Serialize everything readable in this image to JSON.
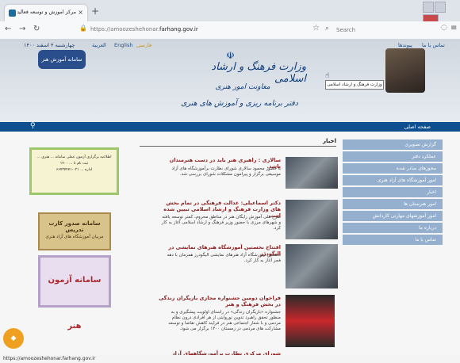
{
  "browser": {
    "tab_title": "مرکز آموزش و توسعه فعالیتهای قرآ",
    "new_tab": "+",
    "url_prefix": "https://amoozeshehonar.",
    "url_domain": "farhang.gov.ir",
    "search_placeholder": "Search",
    "status_url": "https://amoozeshehonar.farhang.gov.ir"
  },
  "header": {
    "date": "چهارشنبه ۴ اسفند ۱۴۰۰",
    "langs": [
      "العربية",
      "English",
      "فارسی"
    ],
    "contact": "تماس با ما",
    "links": "پیوندها",
    "ministry": "وزارت فرهنگ و ارشاد اسلامی",
    "deputy": "معاونت امور هنری",
    "office": "دفتر برنامه ریزی و آموزش های هنری",
    "logo_text": "سامانه آموزش هنر",
    "tooltip": "وزارت فرهنگ و ارشاد اسلامی"
  },
  "nav": {
    "home": "صفحه اصلی",
    "search_icon": "search-icon"
  },
  "menu": [
    "گزارش تصویری",
    "عملکرد دفتر",
    "مجوزهای صادر شده",
    "امور آموزشگاه های آزاد هنری",
    "اخبار",
    "امور هنرستان ها",
    "امور آموزشهای مهارتی کاردانش",
    "درباره ما",
    "تماس با ما"
  ],
  "ads": {
    "ad1_lines": [
      "اطلاعیه برگزاری آزمون عملی سامانه ... هنری ...",
      "ثبت نام تا ... ۱۴۰۰",
      "اداره ... ۰۲۱-۶۶۷۳۷۴۷۱"
    ],
    "ad2_title": "سامانه صدور کارت تدریس",
    "ad2_sub": "مربیان آموزشگاه های آزاد هنری",
    "ad3_title": "سامانه آزمون هنر"
  },
  "news": {
    "heading": "اخبار",
    "items": [
      {
        "title": "سالاری : راهبری هنر باید در دست هنرمندان باشد.",
        "desc": "با حضور محمود سالاری شورای نظارت برآموزشگاه های آزاد موسیقی برگزار و پیرامون مشکلات شورای بررسی شد."
      },
      {
        "title": "دکتر اسماعیلی: عدالت فرهنگی در تمام بخش های وزارت فرهنگ و ارشاد اسلامی تبیین شده است",
        "desc": "طرح ملی آموزش رایگان هنر در مناطق محروم، کمتر توسعه یافته و شهرهای مرزی با حضور وزیر فرهنگ و ارشاد اسلامی آغاز به کار کرد."
      },
      {
        "title": "افتتاح نخستین آموزشگاه هنرهای نمایشی در الیگودرز",
        "desc": "نخستین آموزشگاه آزاد هنرهای نمایشی الیگودرز همزمان با دهه فجر آغاز به کار کرد."
      },
      {
        "title": "فراخوان دومین جشنواره مجازی بازیگران زندگی در بخش فرهنگ و هنر",
        "desc": "جشنواره «بازیگران زندگی» در راستای اولویت پیشگیری و به منظور تحقق راهبرد تدوین نوروایتی از هر افرادی درون نظام مردمی و با شعار اجتماعی هنر در فرایند کاهش تقاضا و توسعه مشارکت های مردمی در زمستان ۱۴۰۰ برگزار می شود."
      },
      {
        "title": "شورای مرکزی نظارت برآموزشگاههای آزاد موسیقی",
        "desc": ""
      }
    ]
  },
  "colors": {
    "nav_blue": "#0f4f8f",
    "menu_blue": "#95b0cf",
    "news_title": "#8a1c1c"
  }
}
